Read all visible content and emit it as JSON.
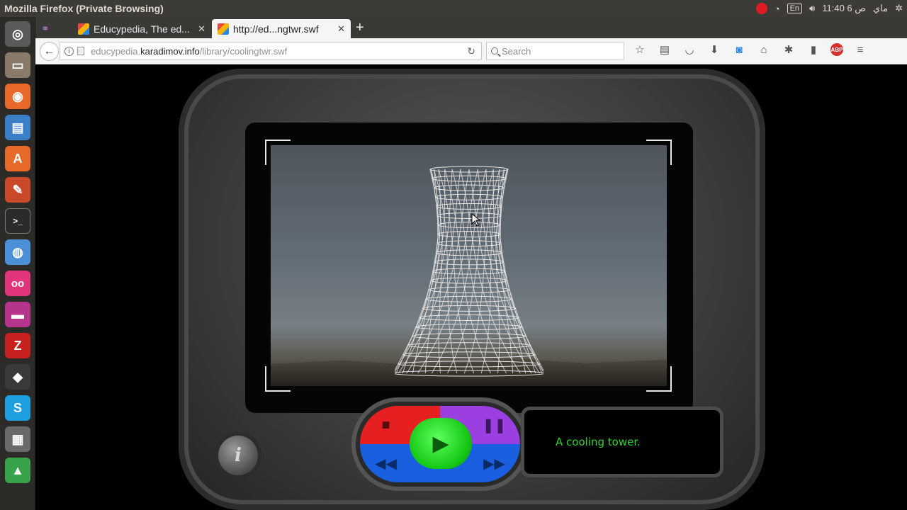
{
  "window": {
    "title": "Mozilla Firefox (Private Browsing)"
  },
  "tray": {
    "keyboard": "En",
    "clock": "11:40 6 ص",
    "date_label": "ماي"
  },
  "tabs": [
    {
      "label": "Educypedia, The ed...",
      "active": false
    },
    {
      "label": "http://ed...ngtwr.swf",
      "active": true
    }
  ],
  "nav": {
    "url_prefix": "educypedia.",
    "url_domain": "karadimov.info",
    "url_path": "/library/coolingtwr.swf",
    "search_placeholder": "Search"
  },
  "player": {
    "caption": "A cooling tower.",
    "info_label": "i"
  },
  "icons": {
    "launcher": [
      "ubuntu-dash-icon",
      "files-icon",
      "firefox-icon",
      "writer-icon",
      "software-center-icon",
      "settings-icon",
      "terminal-icon",
      "chromium-icon",
      "flickr-icon",
      "window-icon",
      "filezilla-icon",
      "inkscape-icon",
      "skype-icon",
      "calculator-icon",
      "drive-icon"
    ]
  }
}
